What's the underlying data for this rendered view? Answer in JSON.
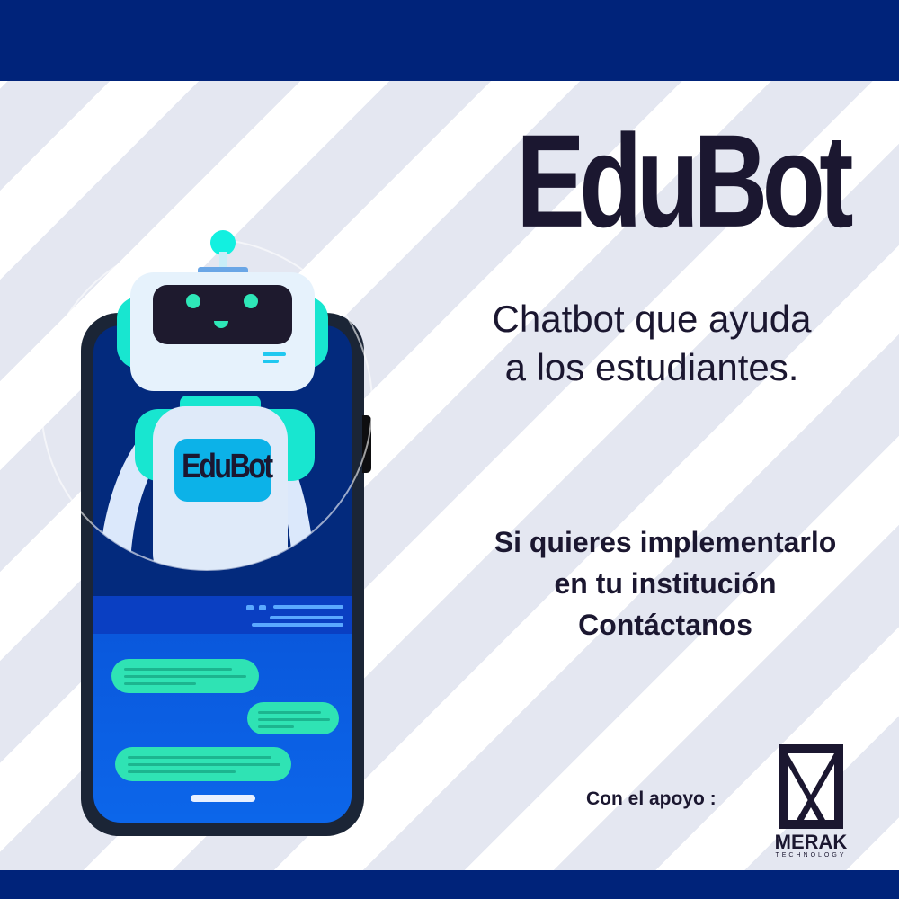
{
  "headline": "EduBot",
  "subtitle_lines": [
    "Chatbot que ayuda",
    "a los estudiantes."
  ],
  "cta_lines": [
    "Si quieres implementarlo",
    "en tu institución",
    "Contáctanos"
  ],
  "support_label": "Con el apoyo :",
  "robot_badge": "EduBot",
  "partner_logo": {
    "name": "MERAK",
    "tagline": "TECHNOLOGY"
  },
  "colors": {
    "navy": "#00237a",
    "stripe": "#e4e7f1",
    "text": "#1b1730",
    "cyan": "#12f0e0",
    "bubble": "#2fe3b4"
  },
  "icons": [
    "robot-illustration",
    "smartphone-illustration",
    "chat-bubble-icon",
    "merak-logo"
  ]
}
